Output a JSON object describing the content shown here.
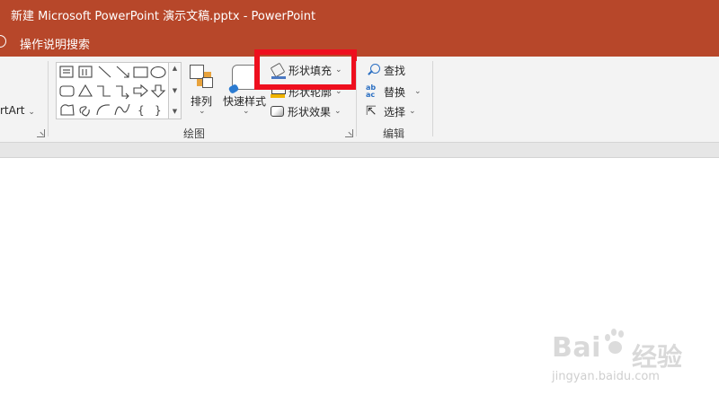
{
  "window": {
    "title": "新建 Microsoft PowerPoint 演示文稿.pptx  -  PowerPoint"
  },
  "tell_me": {
    "placeholder": "操作说明搜索"
  },
  "ribbon": {
    "smartart_label": "rtArt",
    "drawing_group": {
      "label": "绘图",
      "arrange_label": "排列",
      "quick_styles_label": "快速样式",
      "shape_fill_label": "形状填充",
      "shape_outline_label": "形状轮廓",
      "shape_effects_label": "形状效果"
    },
    "editing_group": {
      "label": "编辑",
      "find_label": "查找",
      "replace_label": "替换",
      "select_label": "选择"
    }
  },
  "shapes_gallery": {
    "rows": [
      [
        "text-box",
        "vertical-text-box",
        "line",
        "arrow-line",
        "rectangle",
        "oval"
      ],
      [
        "rounded-rectangle",
        "triangle",
        "elbow-connector",
        "elbow-arrow-connector",
        "right-arrow",
        "down-arrow"
      ],
      [
        "freeform",
        "scribble",
        "arc",
        "curve",
        "left-brace",
        "right-brace"
      ]
    ]
  },
  "watermark": {
    "brand": "Bai",
    "brand_cn": "经验",
    "url": "jingyan.baidu.com"
  },
  "colors": {
    "titlebar": "#b7472a",
    "highlight": "#ee0f1e",
    "ribbon": "#f3f3f3"
  }
}
